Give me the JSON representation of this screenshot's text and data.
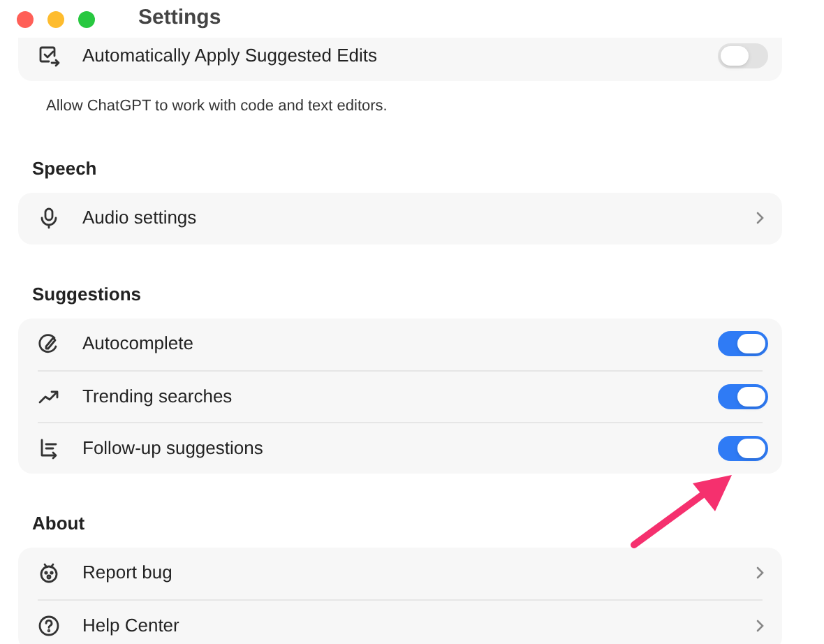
{
  "window": {
    "title": "Settings"
  },
  "sections": [
    {
      "items": [
        {
          "label": "Automatically Apply Suggested Edits",
          "kind": "toggle",
          "on": false
        }
      ],
      "caption": "Allow ChatGPT to work with code and text editors."
    },
    {
      "heading": "Speech",
      "items": [
        {
          "label": "Audio settings",
          "kind": "link"
        }
      ]
    },
    {
      "heading": "Suggestions",
      "items": [
        {
          "label": "Autocomplete",
          "kind": "toggle",
          "on": true
        },
        {
          "label": "Trending searches",
          "kind": "toggle",
          "on": true
        },
        {
          "label": "Follow-up suggestions",
          "kind": "toggle",
          "on": true
        }
      ]
    },
    {
      "heading": "About",
      "items": [
        {
          "label": "Report bug",
          "kind": "link"
        },
        {
          "label": "Help Center",
          "kind": "link"
        }
      ]
    }
  ]
}
